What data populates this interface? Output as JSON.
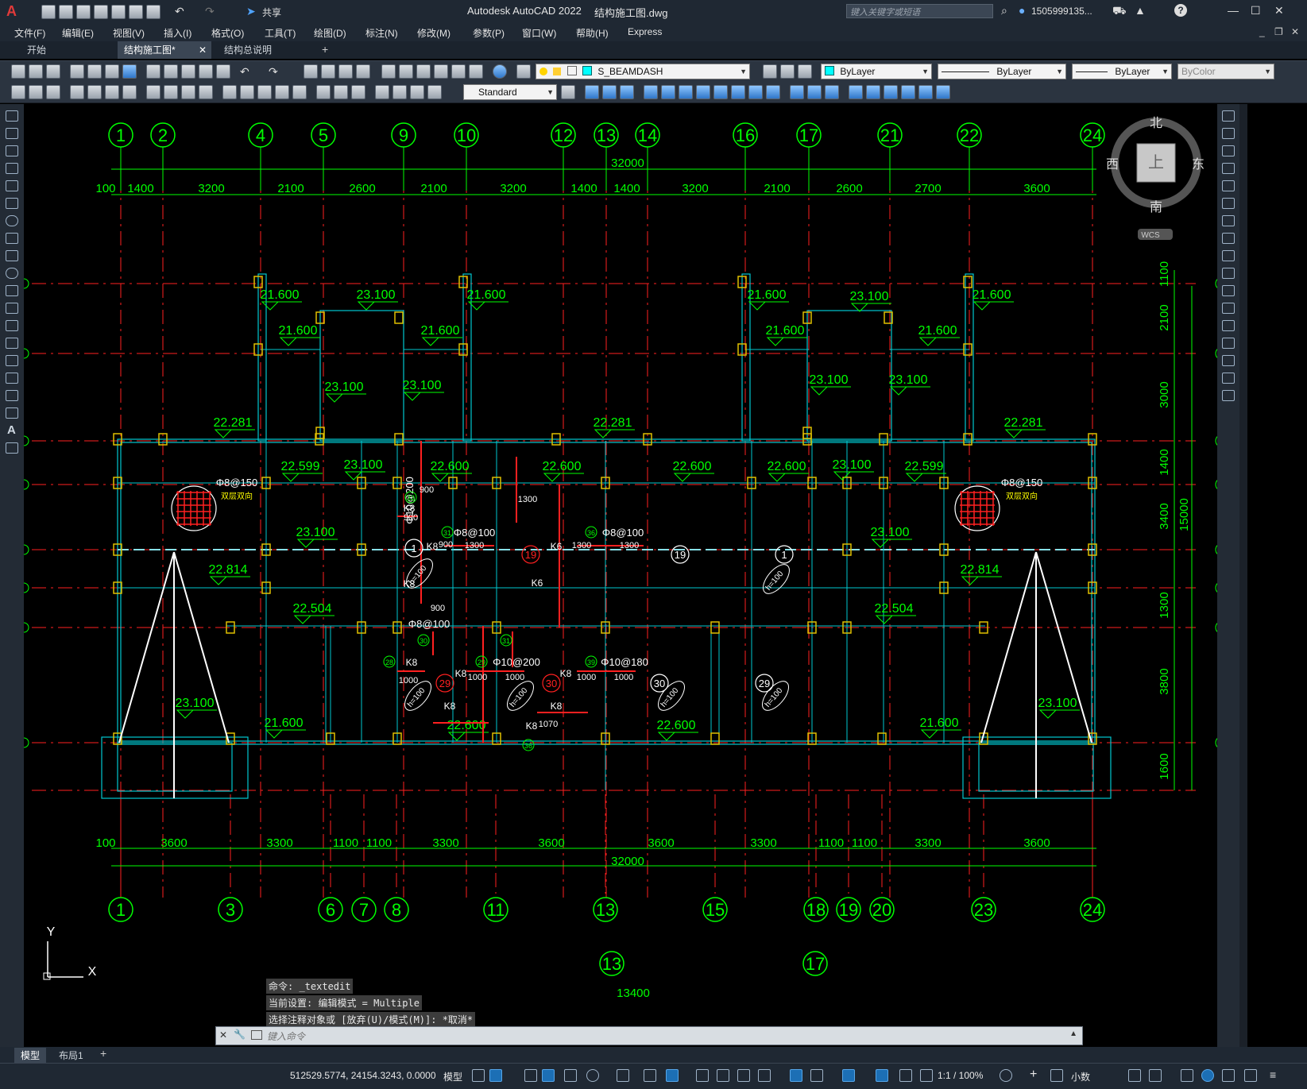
{
  "app": {
    "logo": "A",
    "share_label": "共享",
    "title": "Autodesk AutoCAD 2022",
    "file": "结构施工图.dwg",
    "search_placeholder": "键入关键字或短语",
    "user": "1505999135...",
    "help": "?"
  },
  "menu": [
    "文件(F)",
    "编辑(E)",
    "视图(V)",
    "插入(I)",
    "格式(O)",
    "工具(T)",
    "绘图(D)",
    "标注(N)",
    "修改(M)",
    "参数(P)",
    "窗口(W)",
    "帮助(H)",
    "Express"
  ],
  "tabs": [
    "开始",
    "结构施工图*",
    "结构总说明"
  ],
  "toolbar": {
    "layer": "S_BEAMDASH",
    "color": "ByLayer",
    "linetype": "ByLayer",
    "lineweight": "ByLayer",
    "plotstyle": "ByColor",
    "textstyle": "Standard"
  },
  "viewcube": {
    "north": "北",
    "south": "南",
    "east": "东",
    "west": "西",
    "top": "上",
    "wcs": "WCS"
  },
  "drawing": {
    "axes_top": [
      "1",
      "2",
      "4",
      "5",
      "9",
      "10",
      "12",
      "13",
      "14",
      "16",
      "17",
      "21",
      "22",
      "24"
    ],
    "axes_bottom": [
      "1",
      "3",
      "6",
      "7",
      "8",
      "11",
      "13",
      "15",
      "18",
      "19",
      "20",
      "23",
      "24"
    ],
    "axes_extra": [
      "13",
      "17"
    ],
    "dims_top": [
      "100",
      "1400",
      "3200",
      "2100",
      "2600",
      "2100",
      "3200",
      "1400",
      "1400",
      "3200",
      "2100",
      "2600",
      "2700",
      "3600"
    ],
    "dims_bottom": [
      "100",
      "3600",
      "3300",
      "1100",
      "1100",
      "3300",
      "3600",
      "3600",
      "3300",
      "1100",
      "1100",
      "3300",
      "3600"
    ],
    "total_top": "32000",
    "total_bottom": "32000",
    "dim_extra": "13400",
    "dims_right": [
      "1100",
      "2100",
      "3000",
      "1400",
      "3400",
      "1300",
      "3800",
      "1600"
    ],
    "total_right": "15000",
    "elevations": [
      "21.600",
      "23.100",
      "21.600",
      "21.600",
      "21.600",
      "21.600",
      "23.100",
      "21.600",
      "23.100",
      "23.100",
      "21.600",
      "21.600",
      "23.100",
      "23.100",
      "22.281",
      "22.281",
      "22.281",
      "22.599",
      "23.100",
      "22.600",
      "22.600",
      "22.600",
      "22.600",
      "23.100",
      "22.599",
      "23.100",
      "23.100",
      "22.814",
      "22.814",
      "22.504",
      "22.504",
      "23.100",
      "21.600",
      "22.600",
      "22.600",
      "21.600",
      "23.100"
    ],
    "rebar": [
      "Φ8@150",
      "Φ8@150",
      "Φ8@100",
      "Φ8@100",
      "Φ8@100",
      "Φ10@200",
      "Φ10@180",
      "Φ10@200"
    ],
    "double_layer": "双层双向",
    "slab_notes": [
      "K8",
      "K8",
      "K6",
      "K6",
      "K8",
      "K8",
      "K8",
      "K8",
      "K8",
      "K8",
      "K8"
    ],
    "small_dims": [
      "900",
      "900",
      "1300",
      "1300",
      "1300",
      "1300",
      "900",
      "900",
      "1000",
      "1000",
      "1000",
      "1000",
      "1000",
      "1070"
    ],
    "slab_ids": [
      "1",
      "19",
      "19",
      "1",
      "29",
      "30",
      "30",
      "29"
    ],
    "thickness": "h=100",
    "marks": [
      "33",
      "31",
      "36",
      "30",
      "31",
      "28",
      "29",
      "39",
      "36"
    ]
  },
  "ucs": {
    "x": "X",
    "y": "Y"
  },
  "command": {
    "history": [
      "命令: _textedit",
      "当前设置: 编辑模式 = Multiple",
      "选择注释对象或 [放弃(U)/模式(M)]: *取消*"
    ],
    "placeholder": "键入命令"
  },
  "layout_tabs": [
    "模型",
    "布局1"
  ],
  "status": {
    "coords": "512529.5774, 24154.3243, 0.0000",
    "space": "模型",
    "scale": "1:1 / 100%",
    "units": "小数"
  }
}
